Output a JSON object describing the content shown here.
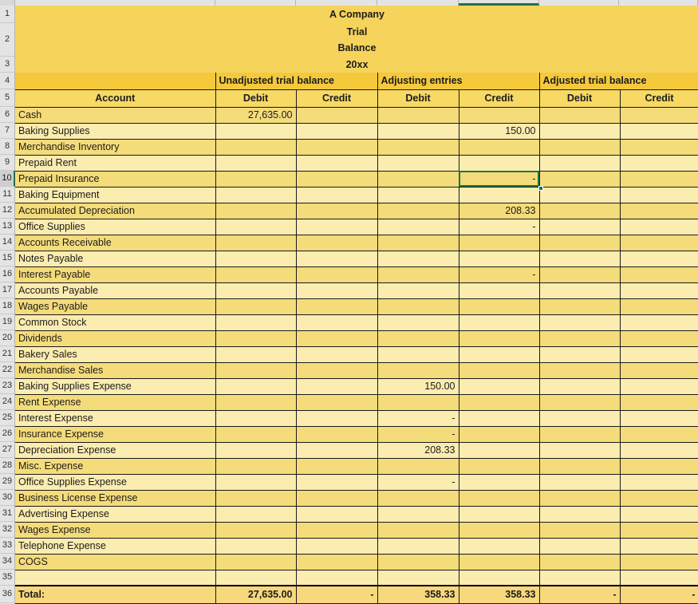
{
  "app": {
    "type": "spreadsheet",
    "selected_cell_value": "-",
    "selected_row_number": "10",
    "selected_column_group": "Adjusting entries",
    "selected_column_name": "Credit",
    "colors": {
      "title_fill": "#f6d35b",
      "group_header_fill": "#f4c93c",
      "subheader_fill": "#f7d964",
      "row_fill_odd": "#f5dc7a",
      "row_fill_even": "#fbecb0",
      "total_fill": "#f7d87d",
      "selection_green": "#217346",
      "gridline": "#1a1a1a",
      "row_header_bg": "#e4e4e4",
      "row_header_active_bg": "#cfcfcf"
    }
  },
  "title_block": {
    "lines": [
      "A Company",
      "Trial",
      "Balance",
      "20xx"
    ],
    "rows": [
      "1",
      "2",
      "3"
    ]
  },
  "group_headers": {
    "row_number": "4",
    "account_blank": "",
    "groups": [
      {
        "label": "Unadjusted trial balance",
        "span": 2
      },
      {
        "label": "Adjusting entries",
        "span": 2
      },
      {
        "label": "Adjusted trial balance",
        "span": 2
      }
    ]
  },
  "column_headers": {
    "row_number": "5",
    "cells": [
      "Account",
      "Debit",
      "Credit",
      "Debit",
      "Credit",
      "Debit",
      "Credit"
    ]
  },
  "rows": [
    {
      "n": "6",
      "account": "Cash",
      "u_debit": "27,635.00",
      "u_credit": "",
      "a_debit": "",
      "a_credit": "",
      "f_debit": "",
      "f_credit": ""
    },
    {
      "n": "7",
      "account": "Baking Supplies",
      "u_debit": "",
      "u_credit": "",
      "a_debit": "",
      "a_credit": "150.00",
      "f_debit": "",
      "f_credit": ""
    },
    {
      "n": "8",
      "account": "Merchandise Inventory",
      "u_debit": "",
      "u_credit": "",
      "a_debit": "",
      "a_credit": "",
      "f_debit": "",
      "f_credit": ""
    },
    {
      "n": "9",
      "account": "Prepaid Rent",
      "u_debit": "",
      "u_credit": "",
      "a_debit": "",
      "a_credit": "",
      "f_debit": "",
      "f_credit": ""
    },
    {
      "n": "10",
      "account": "Prepaid Insurance",
      "u_debit": "",
      "u_credit": "",
      "a_debit": "",
      "a_credit": "-",
      "f_debit": "",
      "f_credit": ""
    },
    {
      "n": "11",
      "account": "Baking Equipment",
      "u_debit": "",
      "u_credit": "",
      "a_debit": "",
      "a_credit": "",
      "f_debit": "",
      "f_credit": ""
    },
    {
      "n": "12",
      "account": "Accumulated Depreciation",
      "u_debit": "",
      "u_credit": "",
      "a_debit": "",
      "a_credit": "208.33",
      "f_debit": "",
      "f_credit": ""
    },
    {
      "n": "13",
      "account": "Office Supplies",
      "u_debit": "",
      "u_credit": "",
      "a_debit": "",
      "a_credit": "-",
      "f_debit": "",
      "f_credit": ""
    },
    {
      "n": "14",
      "account": "Accounts Receivable",
      "u_debit": "",
      "u_credit": "",
      "a_debit": "",
      "a_credit": "",
      "f_debit": "",
      "f_credit": ""
    },
    {
      "n": "15",
      "account": "Notes Payable",
      "u_debit": "",
      "u_credit": "",
      "a_debit": "",
      "a_credit": "",
      "f_debit": "",
      "f_credit": ""
    },
    {
      "n": "16",
      "account": "Interest Payable",
      "u_debit": "",
      "u_credit": "",
      "a_debit": "",
      "a_credit": "-",
      "f_debit": "",
      "f_credit": ""
    },
    {
      "n": "17",
      "account": "Accounts Payable",
      "u_debit": "",
      "u_credit": "",
      "a_debit": "",
      "a_credit": "",
      "f_debit": "",
      "f_credit": ""
    },
    {
      "n": "18",
      "account": "Wages Payable",
      "u_debit": "",
      "u_credit": "",
      "a_debit": "",
      "a_credit": "",
      "f_debit": "",
      "f_credit": ""
    },
    {
      "n": "19",
      "account": "Common Stock",
      "u_debit": "",
      "u_credit": "",
      "a_debit": "",
      "a_credit": "",
      "f_debit": "",
      "f_credit": ""
    },
    {
      "n": "20",
      "account": "Dividends",
      "u_debit": "",
      "u_credit": "",
      "a_debit": "",
      "a_credit": "",
      "f_debit": "",
      "f_credit": ""
    },
    {
      "n": "21",
      "account": "Bakery Sales",
      "u_debit": "",
      "u_credit": "",
      "a_debit": "",
      "a_credit": "",
      "f_debit": "",
      "f_credit": ""
    },
    {
      "n": "22",
      "account": "Merchandise Sales",
      "u_debit": "",
      "u_credit": "",
      "a_debit": "",
      "a_credit": "",
      "f_debit": "",
      "f_credit": ""
    },
    {
      "n": "23",
      "account": "Baking Supplies Expense",
      "u_debit": "",
      "u_credit": "",
      "a_debit": "150.00",
      "a_credit": "",
      "f_debit": "",
      "f_credit": ""
    },
    {
      "n": "24",
      "account": "Rent Expense",
      "u_debit": "",
      "u_credit": "",
      "a_debit": "",
      "a_credit": "",
      "f_debit": "",
      "f_credit": ""
    },
    {
      "n": "25",
      "account": "Interest Expense",
      "u_debit": "",
      "u_credit": "",
      "a_debit": "-",
      "a_credit": "",
      "f_debit": "",
      "f_credit": ""
    },
    {
      "n": "26",
      "account": "Insurance Expense",
      "u_debit": "",
      "u_credit": "",
      "a_debit": "-",
      "a_credit": "",
      "f_debit": "",
      "f_credit": ""
    },
    {
      "n": "27",
      "account": "Depreciation Expense",
      "u_debit": "",
      "u_credit": "",
      "a_debit": "208.33",
      "a_credit": "",
      "f_debit": "",
      "f_credit": ""
    },
    {
      "n": "28",
      "account": "Misc. Expense",
      "u_debit": "",
      "u_credit": "",
      "a_debit": "",
      "a_credit": "",
      "f_debit": "",
      "f_credit": ""
    },
    {
      "n": "29",
      "account": "Office Supplies Expense",
      "u_debit": "",
      "u_credit": "",
      "a_debit": "-",
      "a_credit": "",
      "f_debit": "",
      "f_credit": ""
    },
    {
      "n": "30",
      "account": "Business License Expense",
      "u_debit": "",
      "u_credit": "",
      "a_debit": "",
      "a_credit": "",
      "f_debit": "",
      "f_credit": ""
    },
    {
      "n": "31",
      "account": "Advertising Expense",
      "u_debit": "",
      "u_credit": "",
      "a_debit": "",
      "a_credit": "",
      "f_debit": "",
      "f_credit": ""
    },
    {
      "n": "32",
      "account": "Wages Expense",
      "u_debit": "",
      "u_credit": "",
      "a_debit": "",
      "a_credit": "",
      "f_debit": "",
      "f_credit": ""
    },
    {
      "n": "33",
      "account": "Telephone Expense",
      "u_debit": "",
      "u_credit": "",
      "a_debit": "",
      "a_credit": "",
      "f_debit": "",
      "f_credit": ""
    },
    {
      "n": "34",
      "account": "COGS",
      "u_debit": "",
      "u_credit": "",
      "a_debit": "",
      "a_credit": "",
      "f_debit": "",
      "f_credit": ""
    },
    {
      "n": "35",
      "account": "",
      "u_debit": "",
      "u_credit": "",
      "a_debit": "",
      "a_credit": "",
      "f_debit": "",
      "f_credit": ""
    }
  ],
  "total_row": {
    "n": "36",
    "account": "Total:",
    "u_debit": "27,635.00",
    "u_credit": "-",
    "a_debit": "358.33",
    "a_credit": "358.33",
    "f_debit": "-",
    "f_credit": "-"
  }
}
